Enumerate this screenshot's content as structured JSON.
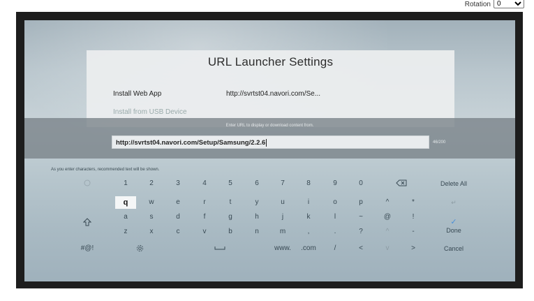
{
  "rotation": {
    "label": "Rotation",
    "value": "0"
  },
  "dialog": {
    "title": "URL Launcher Settings",
    "rows": [
      {
        "label": "Install Web App",
        "value": "http://svrtst04.navori.com/Se..."
      },
      {
        "label": "Install from USB Device",
        "value": ""
      }
    ]
  },
  "url_band": {
    "hint": "Enter URL to display or download content from.",
    "value": "http://svrtst04.navori.com/Setup/Samsung/2.2.6",
    "count": "46/200"
  },
  "suggest_note": "As you enter characters, recommended text will be shown.",
  "keyboard": {
    "row1": [
      "1",
      "2",
      "3",
      "4",
      "5",
      "6",
      "7",
      "8",
      "9",
      "0"
    ],
    "row2": [
      "q",
      "w",
      "e",
      "r",
      "t",
      "y",
      "u",
      "i",
      "o",
      "p",
      "^",
      "*"
    ],
    "row3": [
      "a",
      "s",
      "d",
      "f",
      "g",
      "h",
      "j",
      "k",
      "l",
      "~",
      "@",
      "!"
    ],
    "row4": [
      "z",
      "x",
      "c",
      "v",
      "b",
      "n",
      "m",
      ",",
      ".",
      "?",
      "^",
      "-"
    ],
    "symbols": "#@!",
    "www": "www.",
    "com": ".com",
    "slash": "/",
    "left": "<",
    "down": "v",
    "right": ">",
    "delete_all": "Delete All",
    "done": "Done",
    "cancel": "Cancel",
    "enter": "↵",
    "check": "✓",
    "selected_key": "q"
  }
}
